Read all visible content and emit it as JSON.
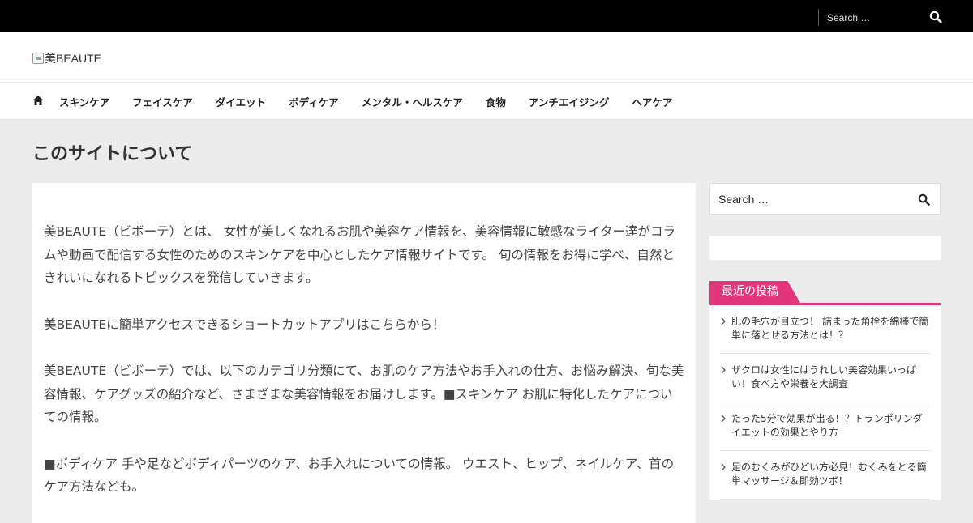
{
  "topbar": {
    "search_placeholder": "Search …"
  },
  "header": {
    "logo_text": "美BEAUTE"
  },
  "nav": {
    "items": [
      "スキンケア",
      "フェイスケア",
      "ダイエット",
      "ボディケア",
      "メンタル・ヘルスケア",
      "食物",
      "アンチエイジング",
      "ヘアケア"
    ]
  },
  "page": {
    "title": "このサイトについて",
    "paragraphs": [
      "美BEAUTE（ビボーテ）とは、 女性が美しくなれるお肌や美容ケア情報を、美容情報に敏感なライター達がコラムや動画で配信する女性のためのスキンケアを中心としたケア情報サイトです。 旬の情報をお得に学べ、自然ときれいになれるトピックスを発信していきます。",
      "美BEAUTEに簡単アクセスできるショートカットアプリはこちらから！",
      "美BEAUTE（ビボーテ）では、以下のカテゴリ分類にて、お肌のケア方法やお手入れの仕方、お悩み解決、旬な美容情報、ケアグッズの紹介など、さまざまな美容情報をお届けします。■スキンケア お肌に特化したケアについての情報。",
      "■ボディケア 手や足などボディパーツのケア、お手入れについての情報。 ウエスト、ヒップ、ネイルケア、首のケア方法なども。"
    ]
  },
  "sidebar": {
    "search_placeholder": "Search …",
    "recent_title": "最近の投稿",
    "recent_posts": [
      "肌の毛穴が目立つ！ 詰まった角栓を綿棒で簡単に落とせる方法とは！？",
      "ザクロは女性にはうれしい美容効果いっぱい！食べ方や栄養を大調査",
      "たった5分で効果が出る！？トランポリンダイエットの効果とやり方",
      "足のむくみがひどい方必見！むくみをとる簡単マッサージ＆即効ツボ！"
    ]
  },
  "colors": {
    "accent": "#e4367a",
    "topbar": "#000000",
    "background": "#ececec"
  }
}
